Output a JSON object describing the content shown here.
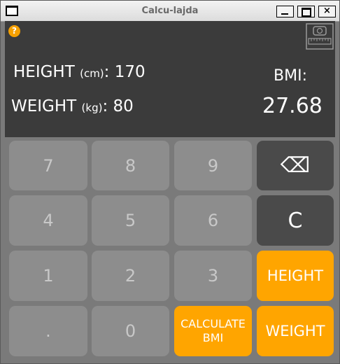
{
  "window": {
    "title": "Calcu-lajda",
    "minimize_label": "",
    "close_label": "×"
  },
  "display": {
    "help_label": "?",
    "height_label": "HEIGHT",
    "height_unit": "(cm)",
    "height_value": "170",
    "weight_label": "WEIGHT",
    "weight_unit": "(kg)",
    "weight_value": "80",
    "bmi_label": "BMI:",
    "bmi_value": "27.68"
  },
  "keypad": {
    "k7": "7",
    "k8": "8",
    "k9": "9",
    "k4": "4",
    "k5": "5",
    "k6": "6",
    "k1": "1",
    "k2": "2",
    "k3": "3",
    "kdot": ".",
    "k0": "0",
    "backspace_label": "⌫",
    "clear_label": "C",
    "height_button": "HEIGHT",
    "weight_button": "WEIGHT",
    "calculate_line1": "CALCULATE",
    "calculate_line2": "BMI"
  },
  "colors": {
    "accent": "#ffa500",
    "display_bg": "#3b3b3b",
    "key_bg": "#8d8d8d",
    "dark_key_bg": "#4a4a4a"
  },
  "icons": [
    "window-menu-icon",
    "help-icon",
    "scale-icon",
    "backspace-icon"
  ]
}
